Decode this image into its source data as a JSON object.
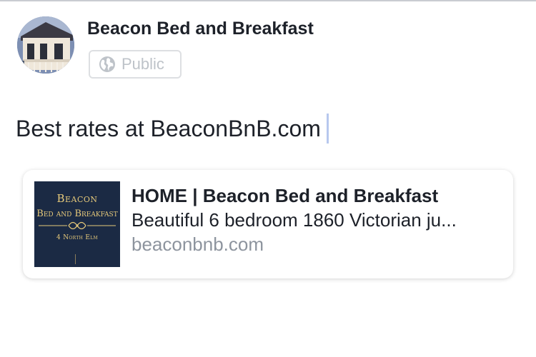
{
  "post": {
    "page_name": "Beacon Bed and Breakfast",
    "audience_label": "Public",
    "audience_icon": "globe-icon",
    "text": "Best rates at BeaconBnB.com"
  },
  "link_preview": {
    "thumbnail": {
      "title": "Beacon",
      "subtitle": "Bed and Breakfast",
      "address": "4 North Elm"
    },
    "title": "HOME | Beacon Bed and Breakfast",
    "description": "Beautiful 6 bedroom 1860 Victorian ju...",
    "domain": "beaconbnb.com"
  },
  "colors": {
    "text_primary": "#1d2129",
    "text_secondary": "#8d949e",
    "audience_text": "#bec3c9",
    "caret": "#b7c8ee",
    "thumbnail_bg": "#1b2a44",
    "thumbnail_gold": "#e6c97a"
  }
}
